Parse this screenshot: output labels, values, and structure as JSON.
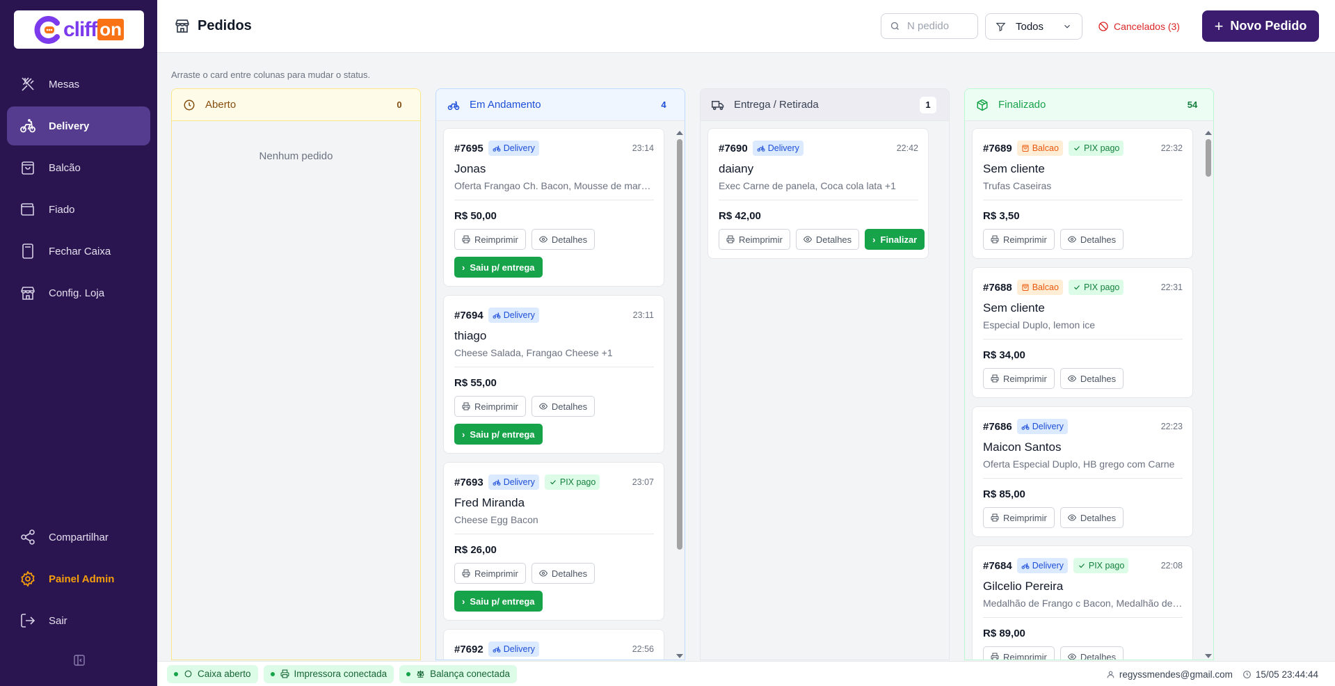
{
  "brand": {
    "logo_main": "cliff",
    "logo_suffix": "on"
  },
  "sidebar": {
    "items": [
      {
        "label": "Mesas",
        "icon": "utensils-icon"
      },
      {
        "label": "Delivery",
        "icon": "bike-icon"
      },
      {
        "label": "Balcão",
        "icon": "shopping-bag-icon"
      },
      {
        "label": "Fiado",
        "icon": "wallet-icon"
      },
      {
        "label": "Fechar Caixa",
        "icon": "calculator-icon"
      },
      {
        "label": "Config. Loja",
        "icon": "store-icon"
      }
    ],
    "bottom": [
      {
        "label": "Compartilhar",
        "icon": "share-icon"
      },
      {
        "label": "Painel Admin",
        "icon": "gear-icon"
      },
      {
        "label": "Sair",
        "icon": "logout-icon"
      }
    ]
  },
  "header": {
    "title": "Pedidos",
    "search_placeholder": "N pedido",
    "filter_value": "Todos",
    "cancelados": "Cancelados (3)",
    "novo_pedido": "Novo Pedido"
  },
  "hint": "Arraste o card entre colunas para mudar o status.",
  "buttons": {
    "reimprimir": "Reimprimir",
    "detalhes": "Detalhes",
    "saiu": "Saiu p/ entrega",
    "finalizar": "Finalizar"
  },
  "badges": {
    "delivery": "Delivery",
    "balcao": "Balcao",
    "pix": "PIX pago"
  },
  "columns": {
    "aberto": {
      "title": "Aberto",
      "count": "0",
      "empty": "Nenhum pedido"
    },
    "andamento": {
      "title": "Em Andamento",
      "count": "4",
      "cards": [
        {
          "id": "#7695",
          "time": "23:14",
          "name": "Jonas",
          "items": "Oferta Frangao Ch. Bacon, Mousse de maracujá",
          "price": "R$ 50,00"
        },
        {
          "id": "#7694",
          "time": "23:11",
          "name": "thiago",
          "items": "Cheese Salada, Frangao Cheese +1",
          "price": "R$ 55,00"
        },
        {
          "id": "#7693",
          "time": "23:07",
          "name": "Fred Miranda",
          "items": "Cheese Egg Bacon",
          "price": "R$ 26,00"
        },
        {
          "id": "#7692",
          "time": "22:56"
        }
      ]
    },
    "entrega": {
      "title": "Entrega / Retirada",
      "count": "1",
      "cards": [
        {
          "id": "#7690",
          "time": "22:42",
          "name": "daiany",
          "items": "Exec Carne de panela, Coca cola lata +1",
          "price": "R$ 42,00"
        }
      ]
    },
    "finalizado": {
      "title": "Finalizado",
      "count": "54",
      "cards": [
        {
          "id": "#7689",
          "time": "22:32",
          "name": "Sem cliente",
          "items": "Trufas Caseiras",
          "price": "R$ 3,50"
        },
        {
          "id": "#7688",
          "time": "22:31",
          "name": "Sem cliente",
          "items": "Especial Duplo, lemon ice",
          "price": "R$ 34,00"
        },
        {
          "id": "#7686",
          "time": "22:23",
          "name": "Maicon Santos",
          "items": "Oferta Especial Duplo, HB grego com Carne",
          "price": "R$ 85,00"
        },
        {
          "id": "#7684",
          "time": "22:08",
          "name": "Gilcelio Pereira",
          "items": "Medalhão de Frango c Bacon, Medalhão de Carne",
          "price": "R$ 89,00"
        }
      ]
    }
  },
  "statusbar": {
    "caixa": "Caixa aberto",
    "impressora": "Impressora conectada",
    "balanca": "Balança conectada",
    "user": "regyssmendes@gmail.com",
    "datetime": "15/05 23:44:44"
  },
  "colors": {
    "sidebar": "#2b1550",
    "primary": "#3b1c6e",
    "accent": "#7c3aed",
    "green": "#16a34a",
    "danger": "#dc2626",
    "admin": "#f59e0b"
  }
}
